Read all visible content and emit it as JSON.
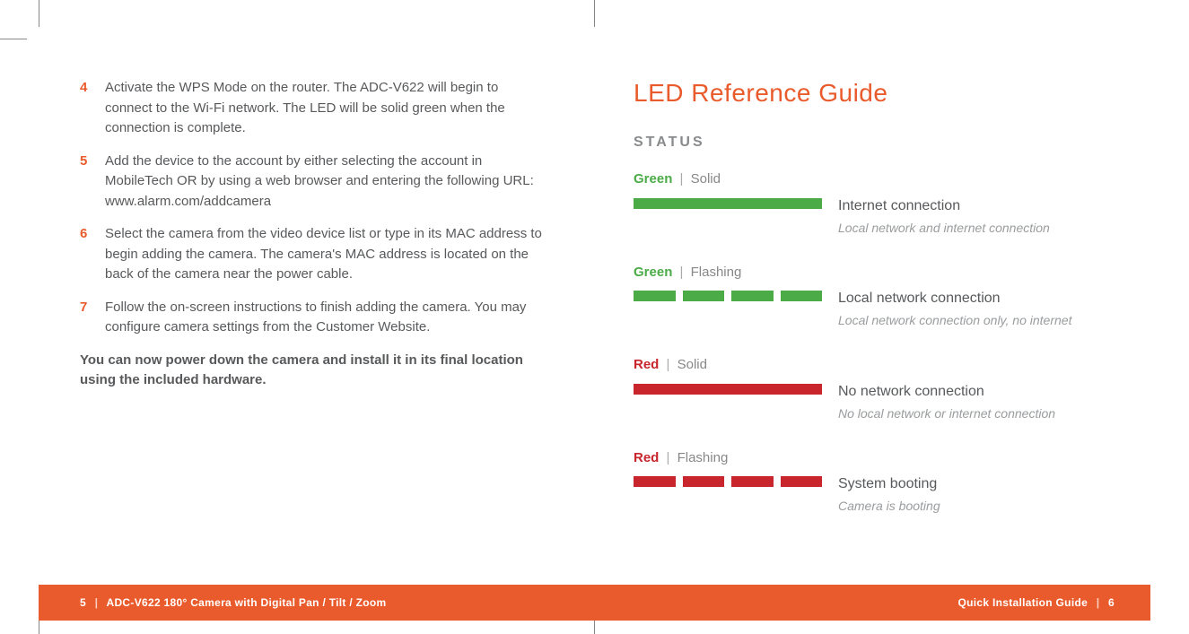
{
  "left_page": {
    "steps": [
      {
        "num": "4",
        "text": "Activate the WPS Mode on the router. The ADC-V622 will begin to connect to the Wi-Fi network. The LED will be solid green when the connection is complete."
      },
      {
        "num": "5",
        "text": "Add the device to the account by either selecting the account in MobileTech OR by using a web browser and entering the following URL: www.alarm.com/addcamera"
      },
      {
        "num": "6",
        "text": "Select the camera from the video device list or type in its MAC address to begin adding the camera. The camera's MAC address is located on the back of the camera near the power cable."
      },
      {
        "num": "7",
        "text": "Follow the on-screen instructions to finish adding the camera. You may configure camera settings from the Customer Website."
      }
    ],
    "closing": "You can now power down the camera and install it in its final location using the included hardware."
  },
  "right_page": {
    "title": "LED Reference Guide",
    "status_label": "STATUS",
    "leds": [
      {
        "color_name": "Green",
        "color_class": "green",
        "mode": "Solid",
        "flash": false,
        "title": "Internet connection",
        "sub": "Local network and internet connection"
      },
      {
        "color_name": "Green",
        "color_class": "green",
        "mode": "Flashing",
        "flash": true,
        "title": "Local network connection",
        "sub": "Local network connection only, no internet"
      },
      {
        "color_name": "Red",
        "color_class": "red",
        "mode": "Solid",
        "flash": false,
        "title": "No network connection",
        "sub": "No local network or internet connection"
      },
      {
        "color_name": "Red",
        "color_class": "red",
        "mode": "Flashing",
        "flash": true,
        "title": "System booting",
        "sub": "Camera is booting"
      }
    ]
  },
  "footer": {
    "left_page_num": "5",
    "left_title": "ADC-V622 180° Camera with Digital Pan / Tilt / Zoom",
    "right_title": "Quick Installation Guide",
    "right_page_num": "6",
    "sep": "|"
  }
}
